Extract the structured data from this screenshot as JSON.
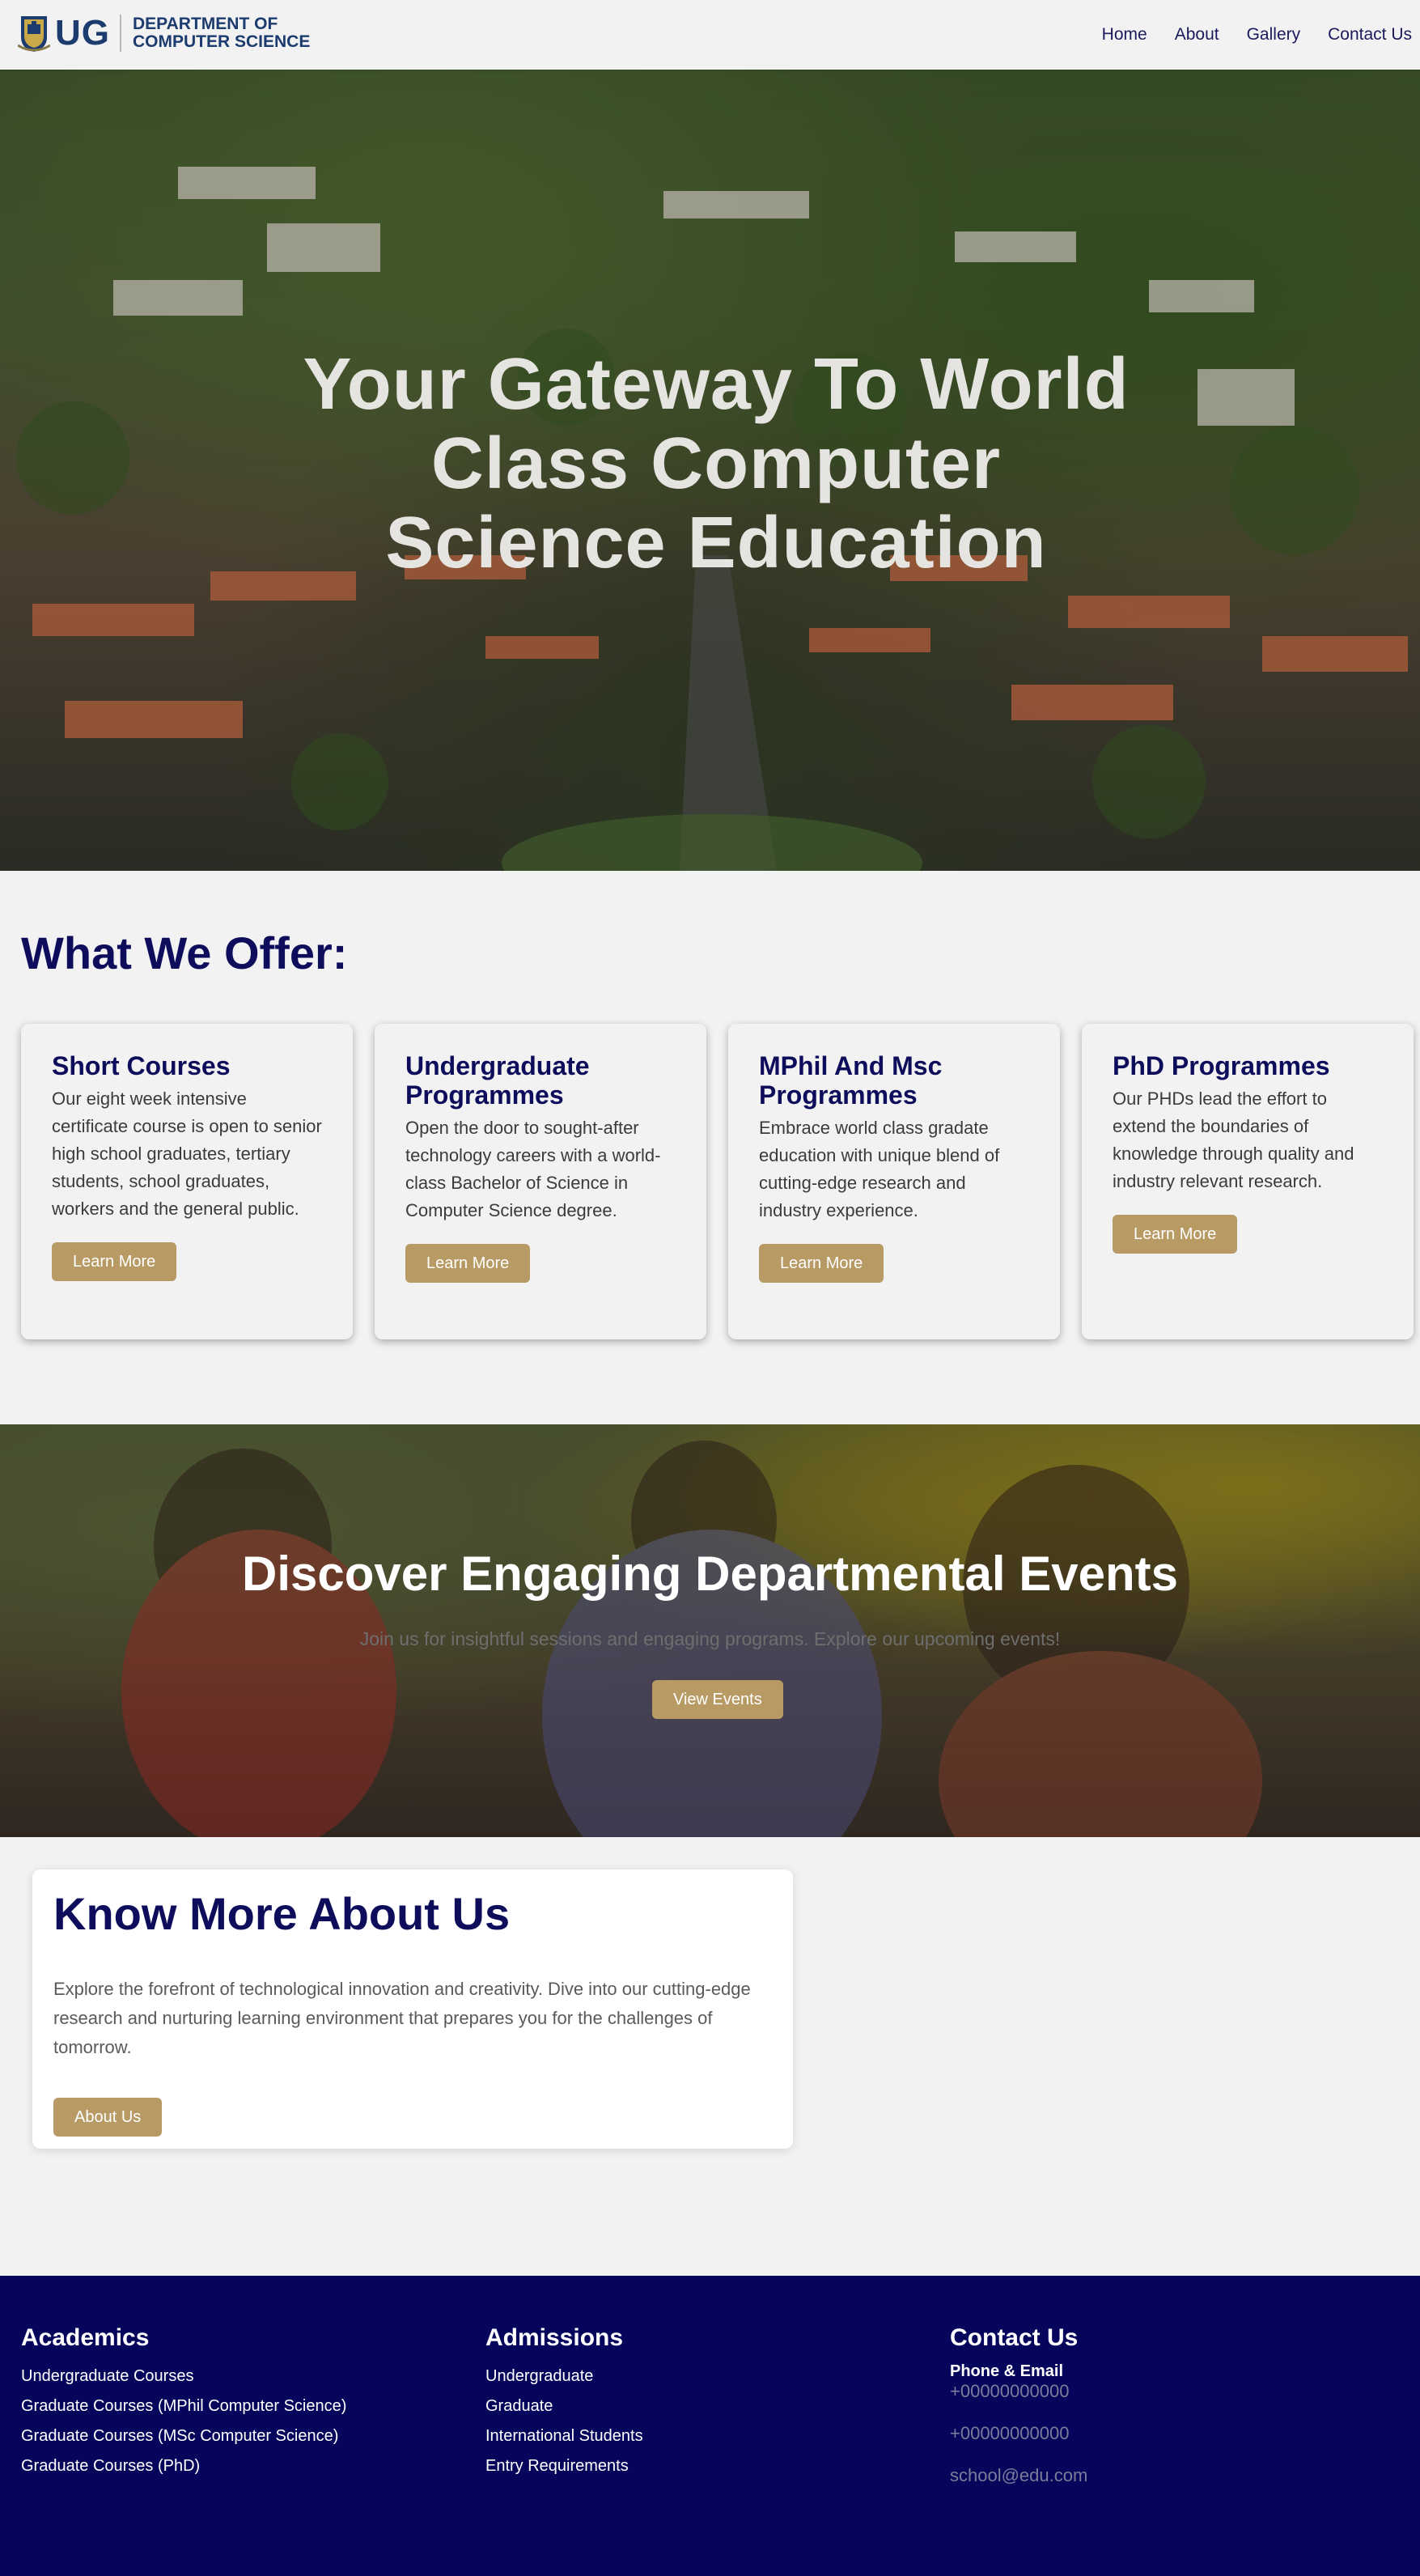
{
  "header": {
    "logo_ug": "UG",
    "logo_line1": "DEPARTMENT OF",
    "logo_line2": "COMPUTER SCIENCE",
    "nav": [
      "Home",
      "About",
      "Gallery",
      "Contact Us"
    ]
  },
  "hero": {
    "title": "Your Gateway To World Class Computer Science Education"
  },
  "offer": {
    "title": "What We Offer:",
    "cards": [
      {
        "title": "Short Courses",
        "text": "Our eight week intensive certificate course is open to senior high school graduates, tertiary students, school graduates, workers and the general public.",
        "button": "Learn More"
      },
      {
        "title": "Undergraduate Programmes",
        "text": "Open the door to sought-after technology careers with a world-class Bachelor of Science in Computer Science degree.",
        "button": "Learn More"
      },
      {
        "title": "MPhil And Msc Programmes",
        "text": "Embrace world class gradate education with unique blend of cutting-edge research and industry experience.",
        "button": "Learn More"
      },
      {
        "title": "PhD Programmes",
        "text": "Our PHDs lead the effort to extend the boundaries of knowledge through quality and industry relevant research.",
        "button": "Learn More"
      }
    ]
  },
  "events": {
    "title": "Discover Engaging Departmental Events",
    "subtitle": "Join us for insightful sessions and engaging programs. Explore our upcoming events!",
    "button": "View Events"
  },
  "about": {
    "title": "Know More About Us",
    "text": "Explore the forefront of technological innovation and creativity. Dive into our cutting-edge research and nurturing learning environment that prepares you for the challenges of tomorrow.",
    "button": "About Us"
  },
  "footer": {
    "academics": {
      "title": "Academics",
      "items": [
        "Undergraduate Courses",
        "Graduate Courses (MPhil Computer Science)",
        "Graduate Courses (MSc Computer Science)",
        "Graduate Courses (PhD)"
      ]
    },
    "admissions": {
      "title": "Admissions",
      "items": [
        "Undergraduate",
        "Graduate",
        "International Students",
        "Entry Requirements"
      ]
    },
    "contact": {
      "title": "Contact Us",
      "label": "Phone & Email",
      "phone1": "+00000000000",
      "phone2": "+00000000000",
      "email": "school@edu.com"
    }
  },
  "colors": {
    "navy": "#0d0d5c",
    "gold_button": "#b89a64",
    "footer_bg": "#05055c"
  }
}
